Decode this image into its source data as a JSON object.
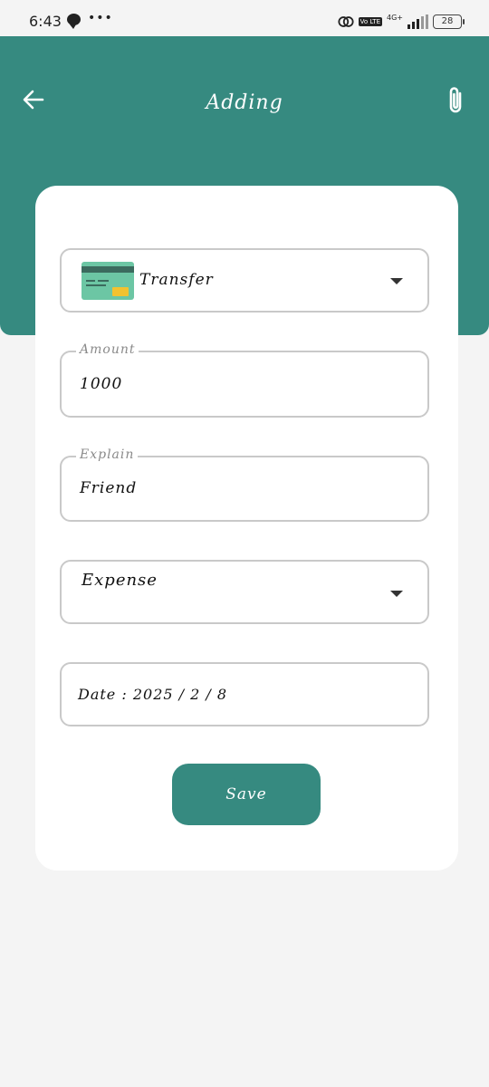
{
  "status_bar": {
    "time": "6:43",
    "dots": "•••",
    "volte": "Vo LTE",
    "network": "4G+",
    "battery": "28"
  },
  "header": {
    "title": "Adding",
    "back_icon": "arrow-left-icon",
    "attach_icon": "paperclip-icon",
    "color": "#368a80"
  },
  "form": {
    "payment_type": {
      "value": "Transfer",
      "icon": "credit-card-icon"
    },
    "amount": {
      "label": "Amount",
      "value": "1000"
    },
    "explain": {
      "label": "Explain",
      "value": "Friend"
    },
    "category": {
      "value": "Expense"
    },
    "date": {
      "value": "Date : 2025 / 2 / 8"
    }
  },
  "save_button": {
    "label": "Save"
  }
}
